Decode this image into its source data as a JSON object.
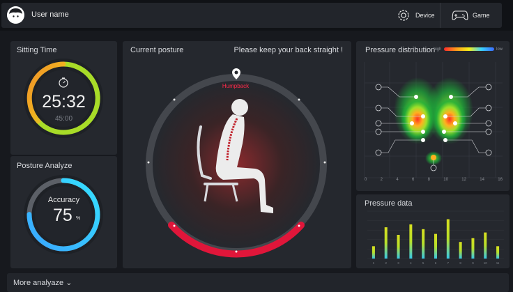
{
  "header": {
    "username": "User name",
    "device_label": "Device",
    "game_label": "Game"
  },
  "sitting": {
    "title": "Sitting Time",
    "time": "25:32",
    "sub_time": "45:00"
  },
  "posture_analyze": {
    "title": "Posture Analyze",
    "label": "Accuracy",
    "value": "75",
    "unit": "%",
    "accuracy_fraction": 0.75
  },
  "current_posture": {
    "title": "Current posture",
    "hint": "Please keep your back straight !",
    "alert_label": "Humpback"
  },
  "pressure_distribution": {
    "title": "Pressure distribution",
    "high_label": "high",
    "low_label": "low",
    "x_ticks": [
      "0",
      "2",
      "4",
      "6",
      "8",
      "10",
      "12",
      "14",
      "16"
    ]
  },
  "pressure_data": {
    "title": "Pressure data"
  },
  "chart_data": {
    "type": "bar",
    "title": "Pressure data",
    "categories": [
      "1",
      "2",
      "3",
      "4",
      "5",
      "6",
      "7",
      "8",
      "9",
      "10",
      "11"
    ],
    "values": [
      26,
      66,
      50,
      72,
      62,
      52,
      83,
      35,
      43,
      55,
      26
    ],
    "ylim": [
      0,
      100
    ],
    "colors": [
      "#35c8e8",
      "#b8e02a",
      "#d8e020"
    ]
  },
  "footer": {
    "more_label": "More analyaze"
  }
}
